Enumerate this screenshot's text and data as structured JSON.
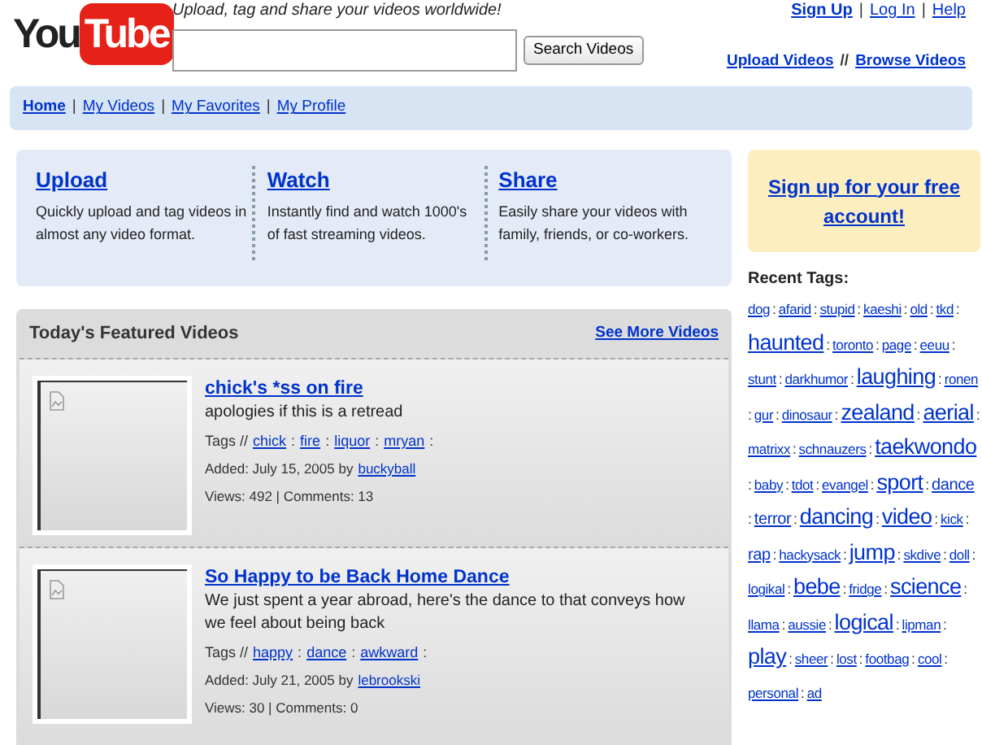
{
  "logo": {
    "first": "You",
    "second": "Tube"
  },
  "tagline": "Upload, tag and share your videos worldwide!",
  "search": {
    "button": "Search Videos"
  },
  "account_links": {
    "separator": "|",
    "items": [
      "Sign Up",
      "Log In",
      "Help"
    ]
  },
  "video_links": {
    "separator": "//",
    "items": [
      "Upload Videos",
      "Browse Videos"
    ]
  },
  "nav": {
    "separator": "|",
    "items": [
      {
        "label": "Home",
        "selected": true
      },
      {
        "label": "My Videos",
        "selected": false
      },
      {
        "label": "My Favorites",
        "selected": false
      },
      {
        "label": "My Profile",
        "selected": false
      }
    ]
  },
  "features": [
    {
      "title": "Upload",
      "text": "Quickly upload and tag videos in almost any video format."
    },
    {
      "title": "Watch",
      "text": "Instantly find and watch 1000's of fast streaming videos."
    },
    {
      "title": "Share",
      "text": "Easily share your videos with family, friends, or co-workers."
    }
  ],
  "featured": {
    "title": "Today's Featured Videos",
    "more": "See More Videos",
    "videos": [
      {
        "title": "chick's *ss on fire",
        "description": "apologies if this is a retread",
        "tags_label": "Tags //",
        "tags": [
          "chick",
          "fire",
          "liquor",
          "mryan"
        ],
        "added": "Added: July 15, 2005 by",
        "user": "buckyball",
        "stats": "Views: 492 | Comments: 13"
      },
      {
        "title": "So Happy to be Back Home Dance",
        "description": "We just spent a year abroad, here's the dance to that conveys how we feel about being back",
        "tags_label": "Tags //",
        "tags": [
          "happy",
          "dance",
          "awkward"
        ],
        "added": "Added: July 21, 2005 by",
        "user": "lebrookski",
        "stats": "Views: 30 | Comments: 0"
      }
    ]
  },
  "signup": "Sign up for your free account!",
  "recent_tags": {
    "title": "Recent Tags:",
    "separator": ":",
    "tags": [
      {
        "label": "dog",
        "kind": "small"
      },
      {
        "label": "afarid",
        "kind": "small"
      },
      {
        "label": "stupid",
        "kind": "small"
      },
      {
        "label": "kaeshi",
        "kind": "small"
      },
      {
        "label": "old",
        "kind": "small"
      },
      {
        "label": "tkd",
        "kind": "small"
      },
      {
        "label": "haunted",
        "kind": "large"
      },
      {
        "label": "toronto",
        "kind": "small"
      },
      {
        "label": "page",
        "kind": "small"
      },
      {
        "label": "eeuu",
        "kind": "small"
      },
      {
        "label": "stunt",
        "kind": "small"
      },
      {
        "label": "darkhumor",
        "kind": "small"
      },
      {
        "label": "laughing",
        "kind": "large"
      },
      {
        "label": "ronen",
        "kind": "small"
      },
      {
        "label": "gur",
        "kind": "small"
      },
      {
        "label": "dinosaur",
        "kind": "small"
      },
      {
        "label": "zealand",
        "kind": "large"
      },
      {
        "label": "aerial",
        "kind": "large"
      },
      {
        "label": "matrixx",
        "kind": "small"
      },
      {
        "label": "schnauzers",
        "kind": "small"
      },
      {
        "label": "taekwondo",
        "kind": "large"
      },
      {
        "label": "baby",
        "kind": "small"
      },
      {
        "label": "tdot",
        "kind": "small"
      },
      {
        "label": "evangel",
        "kind": "small"
      },
      {
        "label": "sport",
        "kind": "large"
      },
      {
        "label": "dance",
        "kind": "medium"
      },
      {
        "label": "terror",
        "kind": "medium"
      },
      {
        "label": "dancing",
        "kind": "large"
      },
      {
        "label": "video",
        "kind": "large"
      },
      {
        "label": "kick",
        "kind": "small"
      },
      {
        "label": "rap",
        "kind": "medium"
      },
      {
        "label": "hackysack",
        "kind": "small"
      },
      {
        "label": "jump",
        "kind": "large"
      },
      {
        "label": "skdive",
        "kind": "small"
      },
      {
        "label": "doll",
        "kind": "small"
      },
      {
        "label": "logikal",
        "kind": "small"
      },
      {
        "label": "bebe",
        "kind": "large"
      },
      {
        "label": "fridge",
        "kind": "small"
      },
      {
        "label": "science",
        "kind": "large"
      },
      {
        "label": "llama",
        "kind": "small"
      },
      {
        "label": "aussie",
        "kind": "small"
      },
      {
        "label": "logical",
        "kind": "large"
      },
      {
        "label": "lipman",
        "kind": "small"
      },
      {
        "label": "play",
        "kind": "large"
      },
      {
        "label": "sheer",
        "kind": "small"
      },
      {
        "label": "lost",
        "kind": "small"
      },
      {
        "label": "footbag",
        "kind": "small"
      },
      {
        "label": "cool",
        "kind": "small"
      },
      {
        "label": "personal",
        "kind": "small"
      },
      {
        "label": "ad",
        "kind": "small"
      }
    ]
  }
}
